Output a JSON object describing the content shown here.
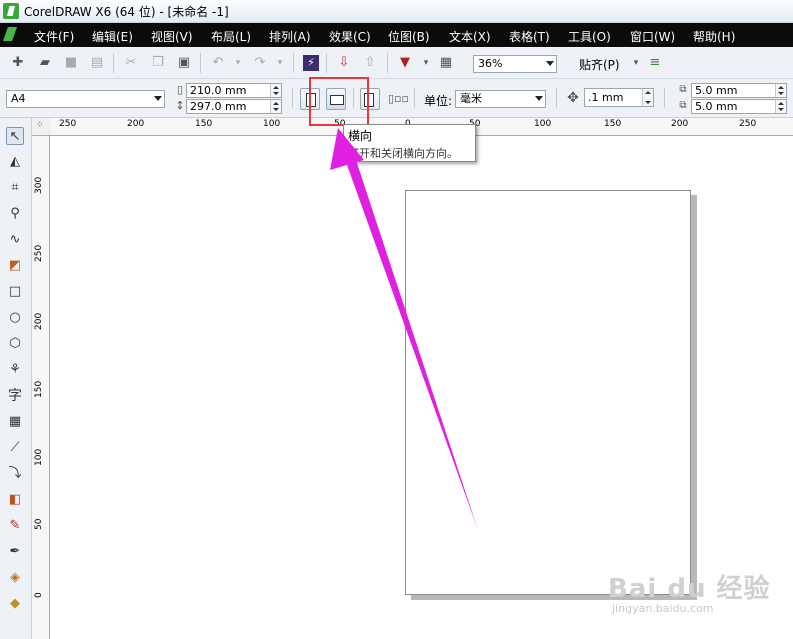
{
  "window": {
    "title": "CorelDRAW X6 (64 位) - [未命名 -1]"
  },
  "menu": {
    "items": [
      "文件(F)",
      "编辑(E)",
      "视图(V)",
      "布局(L)",
      "排列(A)",
      "效果(C)",
      "位图(B)",
      "文本(X)",
      "表格(T)",
      "工具(O)",
      "窗口(W)",
      "帮助(H)"
    ]
  },
  "toolbar": {
    "zoom_value": "36%",
    "snap_label": "贴齐(P)"
  },
  "property_bar": {
    "paper_size": "A4",
    "width": "210.0 mm",
    "height": "297.0 mm",
    "unit_label": "单位:",
    "unit_value": "毫米",
    "nudge_value": ".1 mm",
    "duplicate_x": "5.0 mm",
    "duplicate_y": "5.0 mm"
  },
  "tooltip": {
    "title": "横向",
    "description": "打开和关闭横向方向。"
  },
  "ruler": {
    "horizontal_ticks": [
      "250",
      "200",
      "150",
      "100",
      "50",
      "0",
      "50",
      "100",
      "150",
      "200",
      "250"
    ],
    "vertical_ticks": [
      "300",
      "250",
      "200",
      "150",
      "100",
      "50",
      "0"
    ]
  },
  "toolbox": {
    "text_tool_glyph": "字"
  },
  "watermark": {
    "logo": "Bai du 经验",
    "url": "jingyan.baidu.com"
  },
  "colors": {
    "annotation_arrow": "#e020e0",
    "highlight_box": "#e8363c",
    "menubar": "#0b0b0b"
  }
}
